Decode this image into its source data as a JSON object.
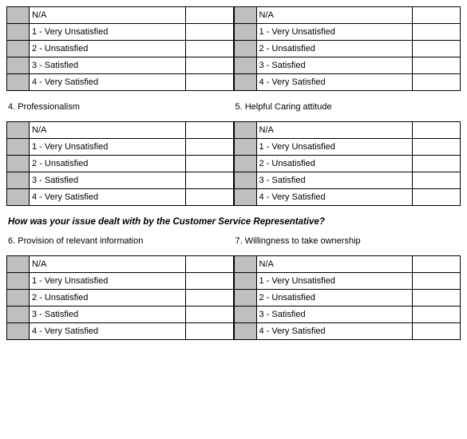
{
  "ratingOptions": [
    "N/A",
    "1 - Very Unsatisfied",
    "2 - Unsatisfied",
    "3 - Satisfied",
    "4 - Very Satisfied"
  ],
  "questions": {
    "q4": "4. Professionalism",
    "q5": "5. Helpful Caring attitude",
    "q6": "6. Provision of relevant information",
    "q7": "7. Willingness to take ownership"
  },
  "sectionHeading": "How was your issue dealt with by the Customer Service Representative?"
}
